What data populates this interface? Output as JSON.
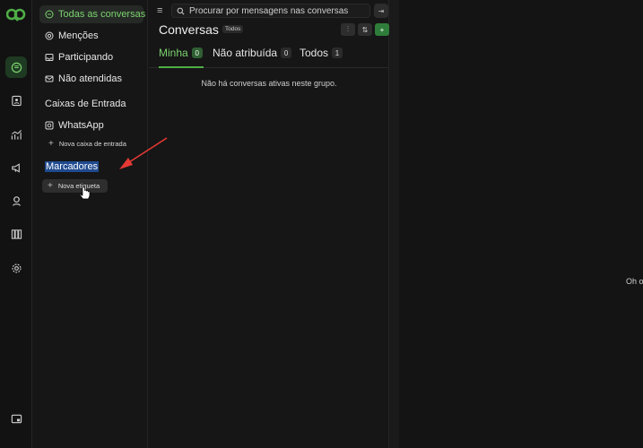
{
  "rail": {
    "logo": "app-logo",
    "items": [
      {
        "name": "rail-conversations-icon",
        "icon": "chat-bubble-icon",
        "active": true
      },
      {
        "name": "rail-contacts-icon",
        "icon": "contact-card-icon",
        "active": false
      },
      {
        "name": "rail-reports-icon",
        "icon": "trend-chart-icon",
        "active": false
      },
      {
        "name": "rail-campaigns-icon",
        "icon": "megaphone-icon",
        "active": false
      },
      {
        "name": "rail-help-icon",
        "icon": "support-agent-icon",
        "active": false
      },
      {
        "name": "rail-kanban-icon",
        "icon": "columns-icon",
        "active": false
      },
      {
        "name": "rail-settings-icon",
        "icon": "gear-icon",
        "active": false
      },
      {
        "name": "rail-toggle-icon",
        "icon": "panel-toggle-icon",
        "active": false
      }
    ]
  },
  "sidebar": {
    "items": [
      {
        "label": "Todas as conversas",
        "icon": "chat-bubble-icon"
      },
      {
        "label": "Menções",
        "icon": "at-sign-icon"
      },
      {
        "label": "Participando",
        "icon": "inbox-icon"
      },
      {
        "label": "Não atendidas",
        "icon": "mail-icon"
      }
    ],
    "inboxes_title": "Caixas de Entrada",
    "inbox_whatsapp": "WhatsApp",
    "new_inbox": "Nova caixa de entrada",
    "labels_title": "Marcadores",
    "new_label": "Nova etiqueta"
  },
  "list": {
    "search_placeholder": "Procurar por mensagens nas conversas",
    "title": "Conversas",
    "status": "Todos",
    "tabs": [
      {
        "label": "Minha",
        "count": "0"
      },
      {
        "label": "Não atribuída",
        "count": "0"
      },
      {
        "label": "Todos",
        "count": "1"
      }
    ],
    "empty_message": "Não há conversas ativas neste grupo."
  },
  "main": {
    "text": "Oh o"
  },
  "colors": {
    "accent": "#4fae46",
    "selection": "#1f4a8f",
    "annotation_arrow": "#e53935"
  }
}
